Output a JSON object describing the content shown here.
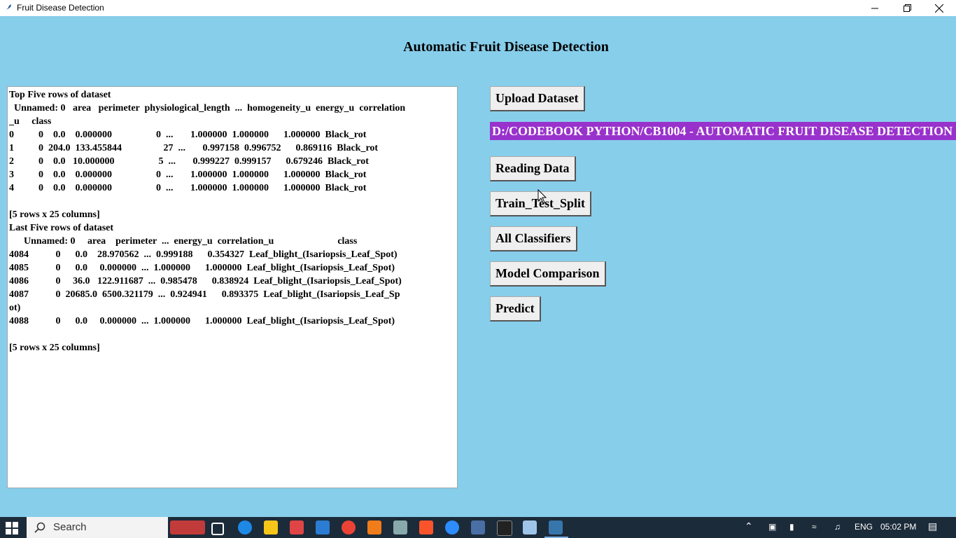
{
  "window": {
    "title": "Fruit Disease Detection"
  },
  "app": {
    "heading": "Automatic Fruit Disease Detection",
    "output_lines": [
      "Top Five rows of dataset",
      "  Unnamed: 0   area   perimeter  physiological_length  ...  homogeneity_u  energy_u  correlation",
      "_u     class",
      "0          0    0.0    0.000000                  0  ...       1.000000  1.000000      1.000000  Black_rot",
      "1          0  204.0  133.455844                 27  ...       0.997158  0.996752      0.869116  Black_rot",
      "2          0    0.0   10.000000                  5  ...       0.999227  0.999157      0.679246  Black_rot",
      "3          0    0.0    0.000000                  0  ...       1.000000  1.000000      1.000000  Black_rot",
      "4          0    0.0    0.000000                  0  ...       1.000000  1.000000      1.000000  Black_rot",
      "",
      "[5 rows x 25 columns]",
      "Last Five rows of dataset",
      "      Unnamed: 0     area    perimeter  ...  energy_u  correlation_u                          class",
      "4084           0      0.0    28.970562  ...  0.999188      0.354327  Leaf_blight_(Isariopsis_Leaf_Spot)",
      "4085           0      0.0     0.000000  ...  1.000000      1.000000  Leaf_blight_(Isariopsis_Leaf_Spot)",
      "4086           0     36.0   122.911687  ...  0.985478      0.838924  Leaf_blight_(Isariopsis_Leaf_Spot)",
      "4087           0  20685.0  6500.321179  ...  0.924941      0.893375  Leaf_blight_(Isariopsis_Leaf_Sp",
      "ot)",
      "4088           0      0.0     0.000000  ...  1.000000      1.000000  Leaf_blight_(Isariopsis_Leaf_Spot)",
      "",
      "[5 rows x 25 columns]"
    ],
    "buttons": {
      "upload": "Upload Dataset",
      "reading": "Reading Data",
      "split": "Train_Test_Split",
      "classifiers": "All Classifiers",
      "comparison": "Model Comparison",
      "predict": "Predict"
    },
    "path_label": "D:/CODEBOOK PYTHON/CB1004 - AUTOMATIC FRUIT DISEASE DETECTION"
  },
  "taskbar": {
    "search_placeholder": "Search",
    "language": "ENG",
    "time": "05:02 PM"
  },
  "colors": {
    "background": "#87ceeb",
    "path_label_bg": "#9932cc",
    "taskbar": "#1c2b3a"
  }
}
